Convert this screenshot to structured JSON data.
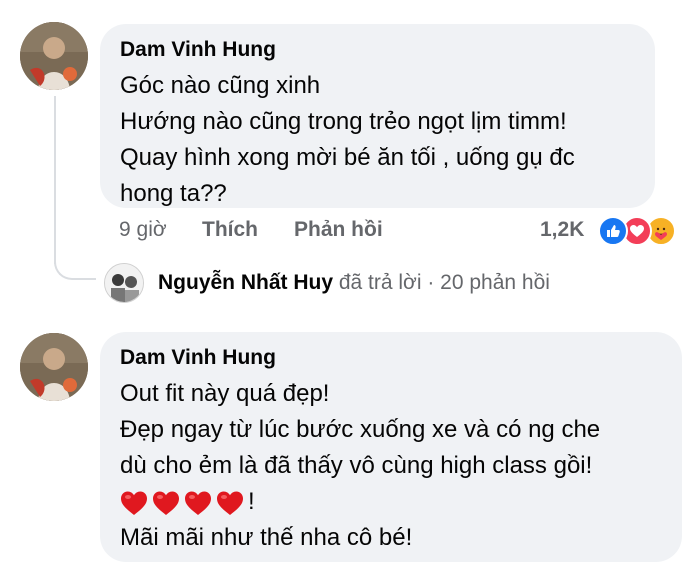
{
  "comments": [
    {
      "author": "Dam Vinh Hung",
      "lines": [
        "Góc nào cũng xinh",
        "Hướng nào cũng trong trẻo ngọt lịm timm!",
        "Quay hình xong mời bé ăn tối , uống gụ đc",
        "hong ta??"
      ],
      "time": "9 giờ",
      "like_label": "Thích",
      "reply_label": "Phản hồi",
      "reaction_count": "1,2K",
      "reaction_icons": [
        "like-icon",
        "love-icon",
        "care-icon"
      ]
    },
    {
      "author": "Dam Vinh Hung",
      "lines": [
        "Out fit này quá đẹp!",
        "Đẹp ngay từ lúc bước xuống xe và có ng che",
        "dù cho ẻm là đã thấy vô cùng high class gồi!"
      ],
      "hearts_suffix": "!",
      "heart_count": 4,
      "last_line": "Mãi mãi như thế nha cô bé!"
    }
  ],
  "reply_summary": {
    "name": "Nguyễn Nhất Huy",
    "text": " đã trả lời · 20 phản hồi"
  },
  "colors": {
    "bubble": "#f0f2f5",
    "meta": "#65676b",
    "like_blue": "#1877f2",
    "love_red": "#f33e58",
    "care_yellow": "#f7b125"
  }
}
